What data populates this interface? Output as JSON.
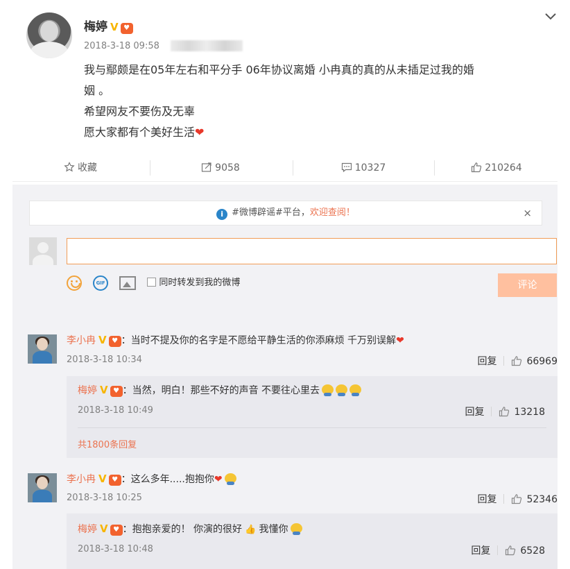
{
  "post": {
    "author": "梅婷",
    "verified_badge": "V",
    "timestamp": "2018-3-18 09:58",
    "lines": [
      "我与鄢颇是在05年左右和平分手 06年协议离婚 小冉真的真的从未插足过我的婚",
      "姻 。",
      "希望网友不要伤及无辜",
      "愿大家都有个美好生活"
    ]
  },
  "actions": {
    "favorite": "收藏",
    "repost_count": "9058",
    "comment_count": "10327",
    "like_count": "210264"
  },
  "comment_box": {
    "notice_prefix": "#微博辟谣#平台，",
    "notice_link": "欢迎查阅！",
    "close": "×",
    "input_value": "",
    "repost_option": "同时转发到我的微博",
    "submit_label": "评论"
  },
  "comments": [
    {
      "author": "李小冉",
      "badge": "V",
      "text": "：当时不提及你的名字是不愿给平静生活的你添麻烦 千万别误解",
      "time": "2018-3-18 10:34",
      "reply": "回复",
      "likes": "66969",
      "sub": {
        "author": "梅婷",
        "badge": "V",
        "text": "：当然，明白！那些不好的声音 不要往心里去",
        "time": "2018-3-18 10:49",
        "reply": "回复",
        "likes": "13218",
        "more": "共1800条回复"
      }
    },
    {
      "author": "李小冉",
      "badge": "V",
      "text": "：这么多年.....抱抱你",
      "time": "2018-3-18 10:25",
      "reply": "回复",
      "likes": "52346",
      "sub": {
        "author": "梅婷",
        "badge": "V",
        "text": "：抱抱亲爱的！ 你演的很好",
        "text2": "我懂你",
        "time": "2018-3-18 10:48",
        "reply": "回复",
        "likes": "6528"
      }
    }
  ],
  "colors": {
    "accent": "#eb7350",
    "heart": "#e8382a",
    "verified": "#f7b500",
    "panel": "#f2f2f5",
    "submit": "#ffc09f"
  }
}
